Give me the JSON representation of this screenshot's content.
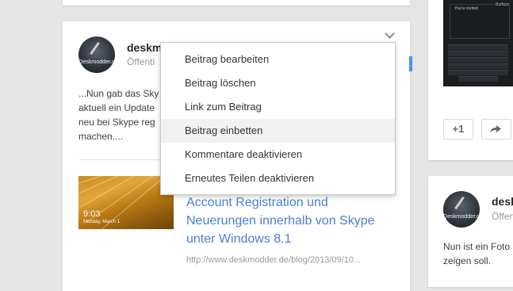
{
  "post": {
    "author": "deskm",
    "visibility": "Öffentl",
    "avatar_text": "Deskmodder.de",
    "text_lines": [
      "...Nun gab das Sky",
      "aktuell ein Update",
      "neu bei Skype reg",
      "machen...."
    ],
    "link": {
      "thumb_time": "9:03",
      "thumb_date": "Monday, March 1",
      "title_lines": [
        "Account Registration und",
        "Neuerungen innerhalb von Skype",
        "unter Windows 8.1"
      ],
      "url": "http://www.deskmodder.de/blog/2013/09/10..."
    }
  },
  "menu": {
    "items": [
      "Beitrag bearbeiten",
      "Beitrag löschen",
      "Link zum Beitrag",
      "Beitrag einbetten",
      "Kommentare deaktivieren",
      "Erneutes Teilen deaktivieren"
    ],
    "highlighted_index": 3
  },
  "right": {
    "image_screen_title": "You're invited",
    "image_brand": "Surface",
    "plus_one_label": "+1",
    "author": "desk",
    "visibility": "Öffen",
    "avatar_text": "Deskmodder.de",
    "text_lines": [
      "Nun ist ein Foto",
      "zeigen soll."
    ]
  },
  "colors": {
    "link": "#4d7ed0",
    "marker": "#4d90fe",
    "menu_highlight": "#f1f1f1"
  }
}
